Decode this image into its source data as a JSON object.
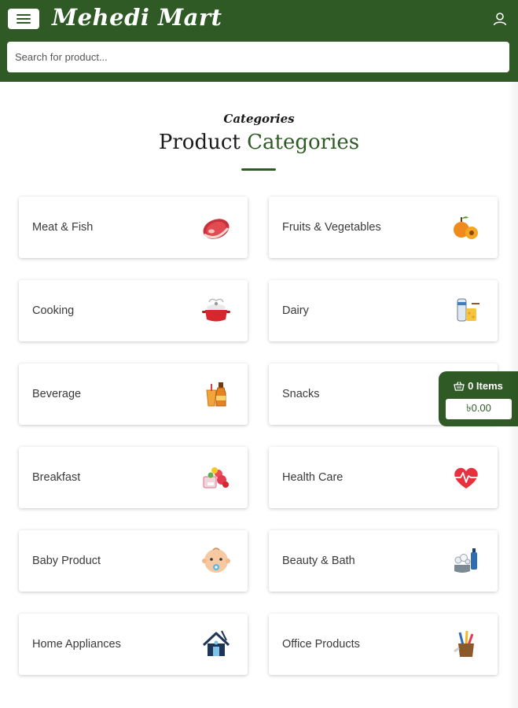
{
  "header": {
    "brand": "Mehedi Mart",
    "search_placeholder": "Search for product..."
  },
  "section": {
    "eyebrow": "Categories",
    "title_main": "Product",
    "title_accent": "Categories"
  },
  "categories": [
    {
      "label": "Meat & Fish",
      "icon": "meat-icon"
    },
    {
      "label": "Fruits & Vegetables",
      "icon": "fruit-icon"
    },
    {
      "label": "Cooking",
      "icon": "cooking-pot-icon"
    },
    {
      "label": "Dairy",
      "icon": "dairy-icon"
    },
    {
      "label": "Beverage",
      "icon": "beverage-icon"
    },
    {
      "label": "Snacks",
      "icon": "snacks-icon"
    },
    {
      "label": "Breakfast",
      "icon": "breakfast-icon"
    },
    {
      "label": "Health Care",
      "icon": "heart-icon"
    },
    {
      "label": "Baby Product",
      "icon": "baby-icon"
    },
    {
      "label": "Beauty & Bath",
      "icon": "beauty-bath-icon"
    },
    {
      "label": "Home Appliances",
      "icon": "home-icon"
    },
    {
      "label": "Office Products",
      "icon": "pencil-cup-icon"
    }
  ],
  "cart": {
    "items_label": "0 Items",
    "total": "৳0.00"
  },
  "colors": {
    "brand_green": "#2f5a25",
    "background": "#ffffff"
  }
}
